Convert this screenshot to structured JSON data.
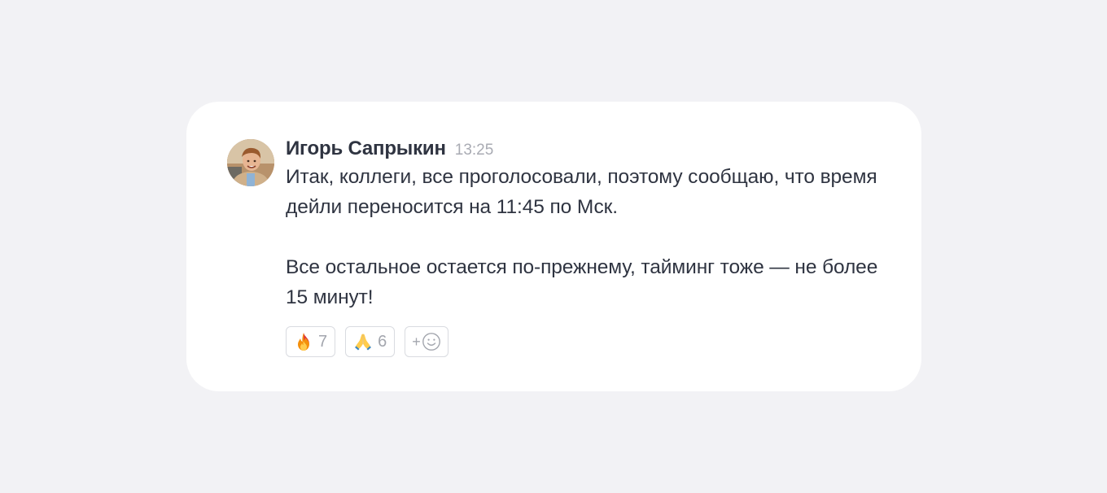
{
  "message": {
    "author": "Игорь Сапрыкин",
    "time": "13:25",
    "paragraphs": [
      "Итак, коллеги, все проголосовали, поэтому сообщаю, что время дейли переносится на 11:45 по Мск.",
      "Все остальное остается по-прежнему, тайминг тоже — не более 15 минут!"
    ]
  },
  "reactions": [
    {
      "icon": "fire-icon",
      "count": "7"
    },
    {
      "icon": "praying-hands-icon",
      "count": "6"
    }
  ],
  "add_reaction": {
    "plus": "+",
    "icon": "smiley-icon"
  },
  "colors": {
    "background": "#f2f2f5",
    "card": "#ffffff",
    "text": "#2f3441",
    "muted": "#a9abb3",
    "border": "#d9dbe0"
  }
}
